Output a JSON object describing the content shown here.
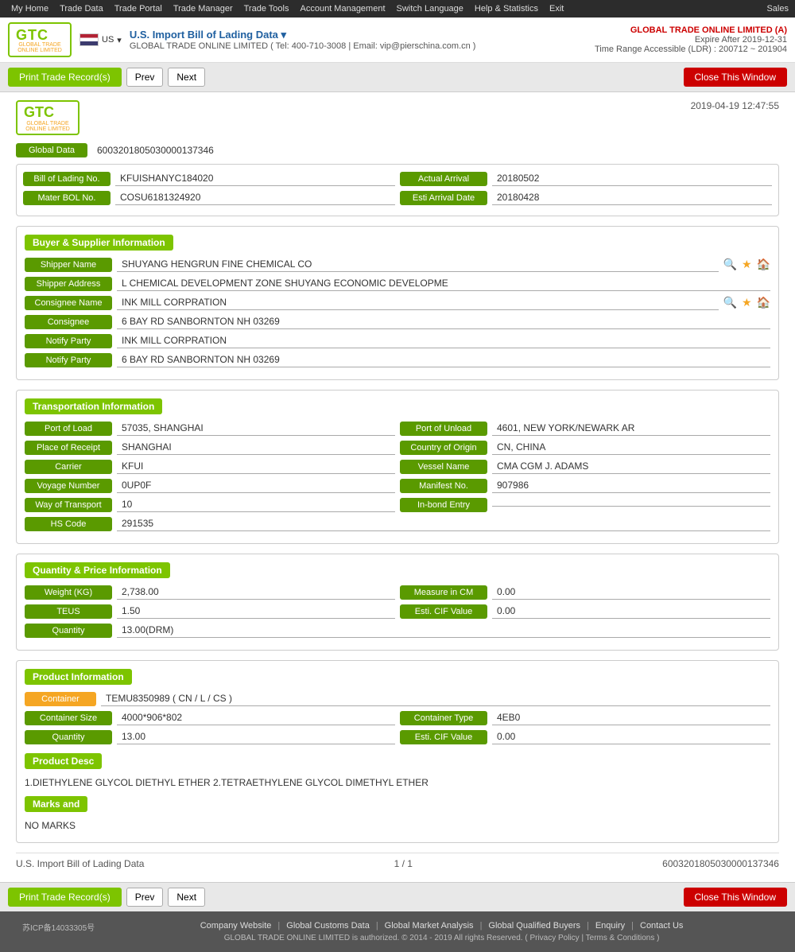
{
  "topnav": {
    "items": [
      "My Home",
      "Trade Data",
      "Trade Portal",
      "Trade Manager",
      "Trade Tools",
      "Account Management",
      "Switch Language",
      "Help & Statistics",
      "Exit"
    ],
    "right": "Sales"
  },
  "header": {
    "logo_text": "GTC",
    "logo_sub": "GLOBAL TRADE ONLINE LIMITED",
    "flag_label": "US",
    "title": "U.S. Import Bill of Lading Data  ▾",
    "contact": "GLOBAL TRADE ONLINE LIMITED ( Tel: 400-710-3008 | Email: vip@pierschina.com.cn )",
    "company": "GLOBAL TRADE ONLINE LIMITED (A)",
    "expire": "Expire After 2019-12-31",
    "time_range": "Time Range Accessible (LDR) : 200712 ~ 201904"
  },
  "toolbar": {
    "print_label": "Print Trade Record(s)",
    "prev_label": "Prev",
    "next_label": "Next",
    "close_label": "Close This Window"
  },
  "record": {
    "timestamp": "2019-04-19 12:47:55",
    "global_data_label": "Global Data",
    "global_data_value": "600320180503000013734​6",
    "bol_no_label": "Bill of Lading No.",
    "bol_no": "KFUISHANYC184020",
    "actual_arrival_label": "Actual Arrival",
    "actual_arrival": "20180502",
    "master_bol_label": "Mater BOL No.",
    "master_bol": "COSU6181324920",
    "esti_arrival_label": "Esti Arrival Date",
    "esti_arrival": "20180428"
  },
  "buyer_supplier": {
    "title": "Buyer & Supplier Information",
    "shipper_name_label": "Shipper Name",
    "shipper_name": "SHUYANG HENGRUN FINE CHEMICAL CO",
    "shipper_addr_label": "Shipper Address",
    "shipper_addr": "L CHEMICAL DEVELOPMENT ZONE SHUYANG ECONOMIC DEVELOPME",
    "consignee_name_label": "Consignee Name",
    "consignee_name": "INK MILL CORPRATION",
    "consignee_label": "Consignee",
    "consignee": "6 BAY RD SANBORNTON NH 03269",
    "notify_party_label": "Notify Party",
    "notify_party": "INK MILL CORPRATION",
    "notify_party2_label": "Notify Party",
    "notify_party2": "6 BAY RD SANBORNTON NH 03269"
  },
  "transport": {
    "title": "Transportation Information",
    "port_load_label": "Port of Load",
    "port_load": "57035, SHANGHAI",
    "port_unload_label": "Port of Unload",
    "port_unload": "4601, NEW YORK/NEWARK AR",
    "place_receipt_label": "Place of Receipt",
    "place_receipt": "SHANGHAI",
    "country_origin_label": "Country of Origin",
    "country_origin": "CN, CHINA",
    "carrier_label": "Carrier",
    "carrier": "KFUI",
    "vessel_name_label": "Vessel Name",
    "vessel_name": "CMA CGM J. ADAMS",
    "voyage_label": "Voyage Number",
    "voyage": "0UP0F",
    "manifest_label": "Manifest No.",
    "manifest": "907986",
    "way_transport_label": "Way of Transport",
    "way_transport": "10",
    "inbond_label": "In-bond Entry",
    "inbond": "",
    "hs_code_label": "HS Code",
    "hs_code": "291535"
  },
  "quantity": {
    "title": "Quantity & Price Information",
    "weight_label": "Weight (KG)",
    "weight": "2,738.00",
    "measure_label": "Measure in CM",
    "measure": "0.00",
    "teus_label": "TEUS",
    "teus": "1.50",
    "cif_label": "Esti. CIF Value",
    "cif": "0.00",
    "quantity_label": "Quantity",
    "quantity": "13.00(DRM)"
  },
  "product": {
    "title": "Product Information",
    "container_label": "Container",
    "container": "TEMU8350989 ( CN / L / CS )",
    "container_size_label": "Container Size",
    "container_size": "4000*906*802",
    "container_type_label": "Container Type",
    "container_type": "4EB0",
    "quantity_label": "Quantity",
    "quantity": "13.00",
    "cif_label": "Esti. CIF Value",
    "cif": "0.00",
    "desc_label": "Product Desc",
    "desc": "1.DIETHYLENE GLYCOL DIETHYL ETHER 2.TETRAETHYLENE GLYCOL DIMETHYL ETHER",
    "marks_label": "Marks and",
    "marks": "NO MARKS"
  },
  "record_footer": {
    "source": "U.S. Import Bill of Lading Data",
    "page": "1 / 1",
    "record_id": "60032018050300001373​46"
  },
  "footer": {
    "icp": "苏ICP备14033305号",
    "links": [
      "Company Website",
      "Global Customs Data",
      "Global Market Analysis",
      "Global Qualified Buyers",
      "Enquiry",
      "Contact Us"
    ],
    "copyright": "GLOBAL TRADE ONLINE LIMITED is authorized. © 2014 - 2019 All rights Reserved.  (  Privacy Policy  |  Terms & Conditions  )"
  }
}
